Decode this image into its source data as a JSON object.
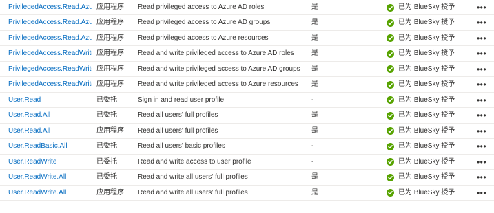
{
  "status_color": "#57a300",
  "link_color": "#0a6fc2",
  "rows": [
    {
      "name": "PrivilegedAccess.Read.AzureAD",
      "type": "应用程序",
      "description": "Read privileged access to Azure AD roles",
      "admin_consent": "是",
      "status": "已为 BlueSky 授予",
      "more": "•••"
    },
    {
      "name": "PrivilegedAccess.Read.AzureADGroup",
      "type": "应用程序",
      "description": "Read privileged access to Azure AD groups",
      "admin_consent": "是",
      "status": "已为 BlueSky 授予",
      "more": "•••"
    },
    {
      "name": "PrivilegedAccess.Read.AzureResources",
      "type": "应用程序",
      "description": "Read privileged access to Azure resources",
      "admin_consent": "是",
      "status": "已为 BlueSky 授予",
      "more": "•••"
    },
    {
      "name": "PrivilegedAccess.ReadWrite.AzureAD",
      "type": "应用程序",
      "description": "Read and write privileged access to Azure AD roles",
      "admin_consent": "是",
      "status": "已为 BlueSky 授予",
      "more": "•••"
    },
    {
      "name": "PrivilegedAccess.ReadWrite.AzureADGroup",
      "type": "应用程序",
      "description": "Read and write privileged access to Azure AD groups",
      "admin_consent": "是",
      "status": "已为 BlueSky 授予",
      "more": "•••"
    },
    {
      "name": "PrivilegedAccess.ReadWrite.AzureResources",
      "type": "应用程序",
      "description": "Read and write privileged access to Azure resources",
      "admin_consent": "是",
      "status": "已为 BlueSky 授予",
      "more": "•••"
    },
    {
      "name": "User.Read",
      "type": "已委托",
      "description": "Sign in and read user profile",
      "admin_consent": "-",
      "status": "已为 BlueSky 授予",
      "more": "•••"
    },
    {
      "name": "User.Read.All",
      "type": "已委托",
      "description": "Read all users' full profiles",
      "admin_consent": "是",
      "status": "已为 BlueSky 授予",
      "more": "•••"
    },
    {
      "name": "User.Read.All",
      "type": "应用程序",
      "description": "Read all users' full profiles",
      "admin_consent": "是",
      "status": "已为 BlueSky 授予",
      "more": "•••"
    },
    {
      "name": "User.ReadBasic.All",
      "type": "已委托",
      "description": "Read all users' basic profiles",
      "admin_consent": "-",
      "status": "已为 BlueSky 授予",
      "more": "•••"
    },
    {
      "name": "User.ReadWrite",
      "type": "已委托",
      "description": "Read and write access to user profile",
      "admin_consent": "-",
      "status": "已为 BlueSky 授予",
      "more": "•••"
    },
    {
      "name": "User.ReadWrite.All",
      "type": "已委托",
      "description": "Read and write all users' full profiles",
      "admin_consent": "是",
      "status": "已为 BlueSky 授予",
      "more": "•••"
    },
    {
      "name": "User.ReadWrite.All",
      "type": "应用程序",
      "description": "Read and write all users' full profiles",
      "admin_consent": "是",
      "status": "已为 BlueSky 授予",
      "more": "•••"
    }
  ]
}
